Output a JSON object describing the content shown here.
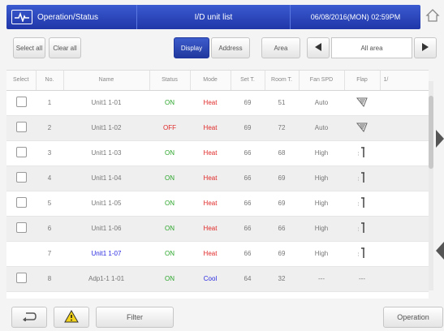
{
  "header": {
    "title": "Operation/Status",
    "center_title": "I/D unit list",
    "datetime": "06/08/2016(MON) 02:59PM"
  },
  "toolbar": {
    "select_all": "Select all",
    "clear_all": "Clear all",
    "display": "Display",
    "address": "Address",
    "area": "Area",
    "area_value": "All area",
    "prev_icon": "triangle-left",
    "next_icon": "triangle-right"
  },
  "columns": [
    "Select",
    "No.",
    "Name",
    "Status",
    "Mode",
    "Set T.",
    "Room T.",
    "Fan SPD",
    "Flap",
    "1/"
  ],
  "rows": [
    {
      "no": "1",
      "name": "Unit1 1-01",
      "status": "ON",
      "mode": "Heat",
      "set_t": "69",
      "room_t": "51",
      "fan": "Auto",
      "flap": "swing"
    },
    {
      "no": "2",
      "name": "Unit1 1-02",
      "status": "OFF",
      "mode": "Heat",
      "set_t": "69",
      "room_t": "72",
      "fan": "Auto",
      "flap": "swing"
    },
    {
      "no": "3",
      "name": "Unit1 1-03",
      "status": "ON",
      "mode": "Heat",
      "set_t": "66",
      "room_t": "68",
      "fan": "High",
      "flap": "down"
    },
    {
      "no": "4",
      "name": "Unit1 1-04",
      "status": "ON",
      "mode": "Heat",
      "set_t": "66",
      "room_t": "69",
      "fan": "High",
      "flap": "down"
    },
    {
      "no": "5",
      "name": "Unit1 1-05",
      "status": "ON",
      "mode": "Heat",
      "set_t": "66",
      "room_t": "69",
      "fan": "High",
      "flap": "down"
    },
    {
      "no": "6",
      "name": "Unit1 1-06",
      "status": "ON",
      "mode": "Heat",
      "set_t": "66",
      "room_t": "66",
      "fan": "High",
      "flap": "down"
    },
    {
      "no": "7",
      "name": "Unit1 1-07",
      "status": "ON",
      "mode": "Heat",
      "set_t": "66",
      "room_t": "69",
      "fan": "High",
      "flap": "down"
    },
    {
      "no": "8",
      "name": "Adp1-1 1-01",
      "status": "ON",
      "mode": "Cool",
      "set_t": "64",
      "room_t": "32",
      "fan": "---",
      "flap": "---"
    }
  ],
  "footer": {
    "filter": "Filter",
    "operation": "Operation"
  },
  "colors": {
    "header_blue": "#1f36a8",
    "on_green": "#2aa52a",
    "off_red": "#e02a2a",
    "cool_blue": "#2a2ae0"
  }
}
